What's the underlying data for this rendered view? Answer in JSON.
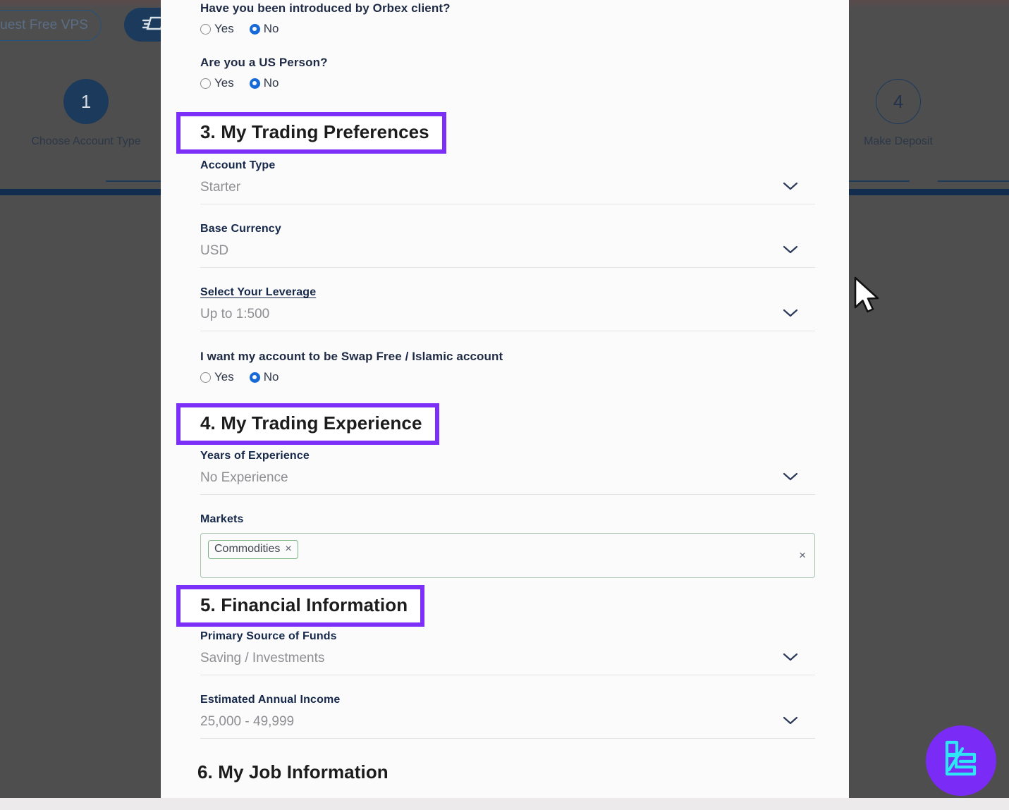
{
  "background": {
    "vps_button_label": "equest Free VPS",
    "nav_icon": "speed-dash-icon",
    "steps": [
      {
        "number": "1",
        "label": "Choose Account Type",
        "state": "filled"
      },
      {
        "number": "4",
        "label": "Make Deposit",
        "state": "hollow"
      }
    ]
  },
  "modal": {
    "questions": [
      {
        "label": "Have you been introduced by Orbex client?",
        "yes": "Yes",
        "no": "No",
        "selected": "No"
      },
      {
        "label": "Are you a US Person?",
        "yes": "Yes",
        "no": "No",
        "selected": "No"
      }
    ],
    "section3": {
      "heading": "3. My Trading Preferences",
      "highlighted": true,
      "fields": [
        {
          "label": "Account Type",
          "value": "Starter",
          "underlined": false
        },
        {
          "label": "Base Currency",
          "value": "USD",
          "underlined": false
        },
        {
          "label": "Select Your Leverage",
          "value": "Up to 1:500",
          "underlined": true
        }
      ],
      "swap_free": {
        "label": "I want my account to be Swap Free / Islamic account",
        "yes": "Yes",
        "no": "No",
        "selected": "No"
      }
    },
    "section4": {
      "heading": "4. My Trading Experience",
      "highlighted": true,
      "fields": [
        {
          "label": "Years of Experience",
          "value": "No Experience",
          "underlined": false
        }
      ],
      "markets": {
        "label": "Markets",
        "chips": [
          {
            "text": "Commodities",
            "remove": "×"
          }
        ],
        "clear": "×"
      }
    },
    "section5": {
      "heading": "5. Financial Information",
      "highlighted": true,
      "fields": [
        {
          "label": "Primary Source of Funds",
          "value": "Saving / Investments",
          "underlined": false
        },
        {
          "label": "Estimated Annual Income",
          "value": "25,000 - 49,999",
          "underlined": false
        }
      ]
    },
    "section6": {
      "heading": "6. My Job Information",
      "highlighted": false
    }
  },
  "overlay": {
    "brand_badge_icon": "brand-e-logo-icon",
    "cursor_icon": "mouse-pointer-icon"
  },
  "colors": {
    "highlight_purple": "#7b2ff7",
    "brand_navy": "#1b3a5c",
    "radio_blue": "#1669d6",
    "badge_purple": "#7a2bf5",
    "badge_glyph_cyan": "#2ee6f6"
  }
}
